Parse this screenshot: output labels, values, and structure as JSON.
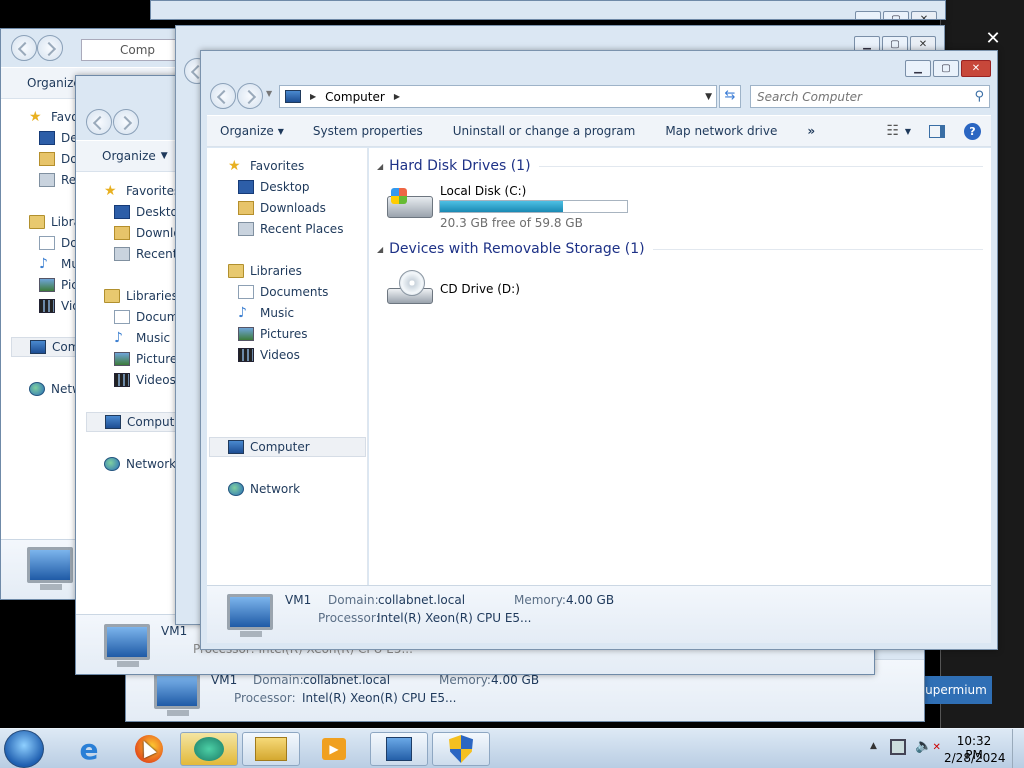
{
  "window": {
    "title_location": "Computer",
    "address_crumb": "Computer",
    "search_placeholder": "Search Computer",
    "toolbar": {
      "organize": "Organize",
      "system_properties": "System properties",
      "uninstall": "Uninstall or change a program",
      "map_network": "Map network drive",
      "more": "»"
    },
    "nav": {
      "favorites": "Favorites",
      "desktop": "Desktop",
      "downloads": "Downloads",
      "recent_places": "Recent Places",
      "libraries": "Libraries",
      "documents": "Documents",
      "music": "Music",
      "pictures": "Pictures",
      "videos": "Videos",
      "computer": "Computer",
      "network": "Network"
    },
    "groups": {
      "hard_disks": "Hard Disk Drives (1)",
      "removable": "Devices with Removable Storage (1)"
    },
    "drives": {
      "c_name": "Local Disk (C:)",
      "c_free": "20.3 GB free of 59.8 GB",
      "c_used_fraction": 0.66,
      "d_name": "CD Drive (D:)"
    },
    "details": {
      "name": "VM1",
      "domain_label": "Domain:",
      "domain_value": "collabnet.local",
      "memory_label": "Memory:",
      "memory_value": "4.00 GB",
      "processor_label": "Processor:",
      "processor_value": "Intel(R) Xeon(R) CPU E5..."
    }
  },
  "background_windows": {
    "w1": {
      "crumb": "Comp",
      "organize": "Organize",
      "favorites": "Favo",
      "desktop": "Des",
      "downloads": "Do",
      "recent": "Rec",
      "libraries": "Libra",
      "documents": "Do",
      "music": "Mu",
      "pictures": "Pic",
      "videos": "Vid",
      "computer": "Com",
      "network": "Netw"
    },
    "w2": {
      "organize": "Organize",
      "favorites": "Favorites",
      "desktop": "Desktop",
      "downloads": "Downlo",
      "recent": "Recent P",
      "libraries": "Libraries",
      "documents": "Docume",
      "music": "Music",
      "pictures": "Pictures",
      "videos": "Videos",
      "computer": "Compute",
      "network": "Network",
      "vm": "VM1",
      "processor": "Processor: Intel(R) Xeon(R) CPU E5..."
    },
    "w3": {
      "vm": "VM1",
      "domain_label": "Domain:",
      "domain_value": "collabnet.local",
      "memory_label": "Memory:",
      "memory_value": "4.00 GB",
      "processor_label": "Processor:",
      "processor_value": "Intel(R) Xeon(R) CPU E5..."
    },
    "partial_text": "upermium"
  },
  "taskbar": {
    "time": "10:32 PM",
    "date": "2/28/2024"
  },
  "colors": {
    "progress": "#25a0cc",
    "close_red": "#c7473a",
    "taskbar": "#c8d8ea"
  }
}
